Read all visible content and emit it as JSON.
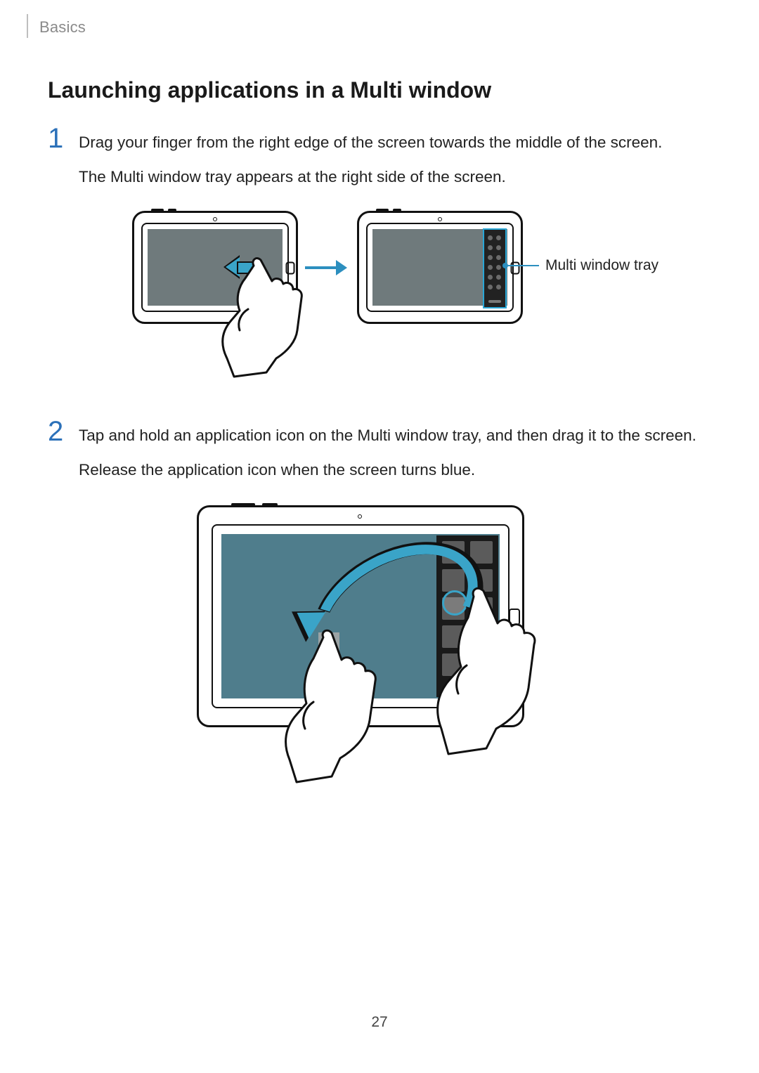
{
  "header": {
    "section": "Basics"
  },
  "title": "Launching applications in a Multi window",
  "steps": [
    {
      "num": "1",
      "lines": [
        "Drag your finger from the right edge of the screen towards the middle of the screen.",
        "The Multi window tray appears at the right side of the screen."
      ]
    },
    {
      "num": "2",
      "lines": [
        "Tap and hold an application icon on the Multi window tray, and then drag it to the screen.",
        "Release the application icon when the screen turns blue."
      ]
    }
  ],
  "callouts": {
    "tray": "Multi window tray"
  },
  "page_number": "27"
}
